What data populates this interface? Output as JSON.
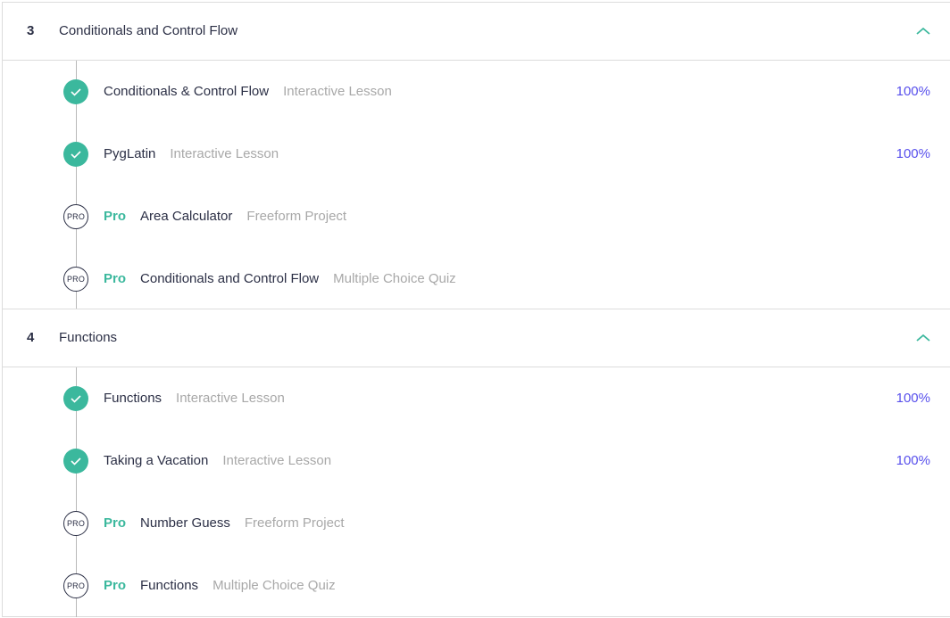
{
  "modules": [
    {
      "number": "3",
      "title": "Conditionals and Control Flow",
      "expanded": true,
      "items": [
        {
          "status": "complete",
          "pro_label": "",
          "name": "Conditionals & Control Flow",
          "type": "Interactive Lesson",
          "progress": "100%"
        },
        {
          "status": "complete",
          "pro_label": "",
          "name": "PygLatin",
          "type": "Interactive Lesson",
          "progress": "100%"
        },
        {
          "status": "pro",
          "pro_badge": "PRO",
          "pro_label": "Pro",
          "name": "Area Calculator",
          "type": "Freeform Project",
          "progress": ""
        },
        {
          "status": "pro",
          "pro_badge": "PRO",
          "pro_label": "Pro",
          "name": "Conditionals and Control Flow",
          "type": "Multiple Choice Quiz",
          "progress": ""
        }
      ]
    },
    {
      "number": "4",
      "title": "Functions",
      "expanded": true,
      "items": [
        {
          "status": "complete",
          "pro_label": "",
          "name": "Functions",
          "type": "Interactive Lesson",
          "progress": "100%"
        },
        {
          "status": "complete",
          "pro_label": "",
          "name": "Taking a Vacation",
          "type": "Interactive Lesson",
          "progress": "100%"
        },
        {
          "status": "pro",
          "pro_badge": "PRO",
          "pro_label": "Pro",
          "name": "Number Guess",
          "type": "Freeform Project",
          "progress": ""
        },
        {
          "status": "pro",
          "pro_badge": "PRO",
          "pro_label": "Pro",
          "name": "Functions",
          "type": "Multiple Choice Quiz",
          "progress": ""
        }
      ]
    }
  ],
  "colors": {
    "accent_green": "#3bb89d",
    "progress_purple": "#5850ec",
    "text_dark": "#2b2f45",
    "text_muted": "#a8a8a8"
  },
  "icons": {
    "complete": "check-circle-icon",
    "pro": "pro-badge-icon",
    "expand": "chevron-up-icon"
  }
}
